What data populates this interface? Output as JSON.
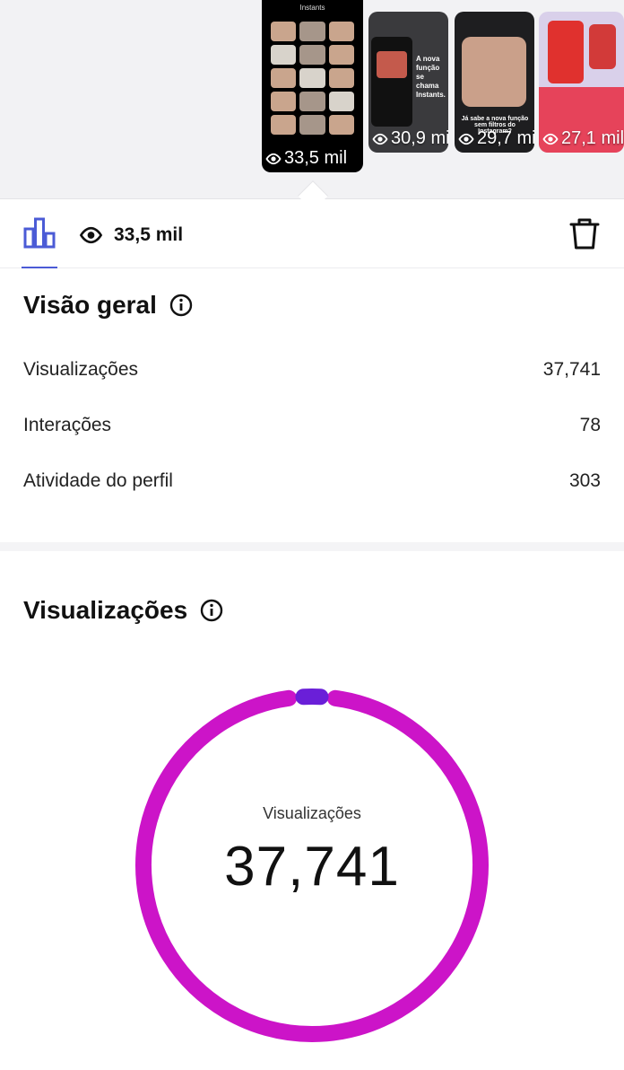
{
  "thumbnails": [
    {
      "views": "33,5 mil",
      "brand": "Instants",
      "selected": true
    },
    {
      "views": "30,9 mil",
      "caption": "A nova função se chama Instants."
    },
    {
      "views": "29,7 mil",
      "caption": "Já sabe a nova função sem filtros do Instagram?"
    },
    {
      "views": "27,1 mil"
    }
  ],
  "toolbar": {
    "tab_icon": "bar-chart-icon",
    "views": "33,5 mil",
    "delete_icon": "trash-icon",
    "accent": "#4b5bd6"
  },
  "overview": {
    "title": "Visão geral",
    "metrics": [
      {
        "label": "Visualizações",
        "value": "37,741"
      },
      {
        "label": "Interações",
        "value": "78"
      },
      {
        "label": "Atividade do perfil",
        "value": "303"
      }
    ]
  },
  "views_section": {
    "title": "Visualizações",
    "donut_label": "Visualizações",
    "donut_value": "37,741"
  },
  "chart_data": {
    "type": "pie",
    "title": "Visualizações",
    "total_label": "37,741",
    "slices": [
      {
        "value": 0.97,
        "color": "#cc14c8"
      },
      {
        "value": 0.03,
        "color": "#6a1fd8"
      }
    ]
  }
}
